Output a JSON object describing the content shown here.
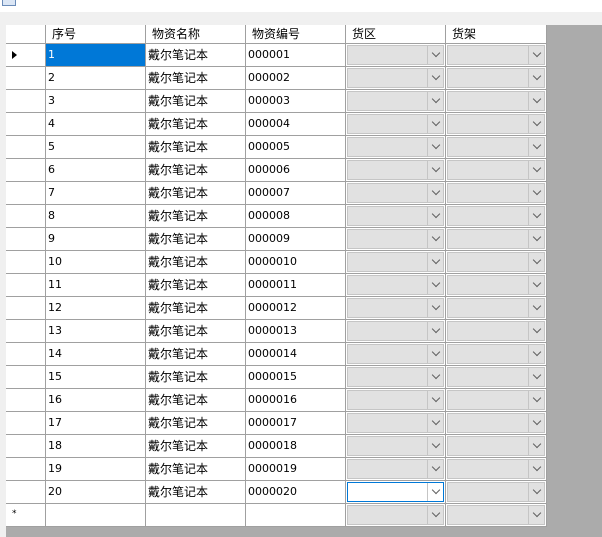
{
  "grid": {
    "columns": [
      "序号",
      "物资名称",
      "物资编号",
      "货区",
      "货架"
    ],
    "rows": [
      {
        "num": "1",
        "name": "戴尔笔记本",
        "code": "000001"
      },
      {
        "num": "2",
        "name": "戴尔笔记本",
        "code": "000002"
      },
      {
        "num": "3",
        "name": "戴尔笔记本",
        "code": "000003"
      },
      {
        "num": "4",
        "name": "戴尔笔记本",
        "code": "000004"
      },
      {
        "num": "5",
        "name": "戴尔笔记本",
        "code": "000005"
      },
      {
        "num": "6",
        "name": "戴尔笔记本",
        "code": "000006"
      },
      {
        "num": "7",
        "name": "戴尔笔记本",
        "code": "000007"
      },
      {
        "num": "8",
        "name": "戴尔笔记本",
        "code": "000008"
      },
      {
        "num": "9",
        "name": "戴尔笔记本",
        "code": "000009"
      },
      {
        "num": "10",
        "name": "戴尔笔记本",
        "code": "0000010"
      },
      {
        "num": "11",
        "name": "戴尔笔记本",
        "code": "0000011"
      },
      {
        "num": "12",
        "name": "戴尔笔记本",
        "code": "0000012"
      },
      {
        "num": "13",
        "name": "戴尔笔记本",
        "code": "0000013"
      },
      {
        "num": "14",
        "name": "戴尔笔记本",
        "code": "0000014"
      },
      {
        "num": "15",
        "name": "戴尔笔记本",
        "code": "0000015"
      },
      {
        "num": "16",
        "name": "戴尔笔记本",
        "code": "0000016"
      },
      {
        "num": "17",
        "name": "戴尔笔记本",
        "code": "0000017"
      },
      {
        "num": "18",
        "name": "戴尔笔记本",
        "code": "0000018"
      },
      {
        "num": "19",
        "name": "戴尔笔记本",
        "code": "0000019"
      },
      {
        "num": "20",
        "name": "戴尔笔记本",
        "code": "0000020"
      }
    ],
    "new_row_marker": "*",
    "current_row_marker_icon": "triangle-right-icon",
    "dropdown_icon": "chevron-down-icon",
    "colors": {
      "selection": "#0078d7",
      "combo_background": "#e1e1e1",
      "empty_area": "#ababab"
    }
  }
}
